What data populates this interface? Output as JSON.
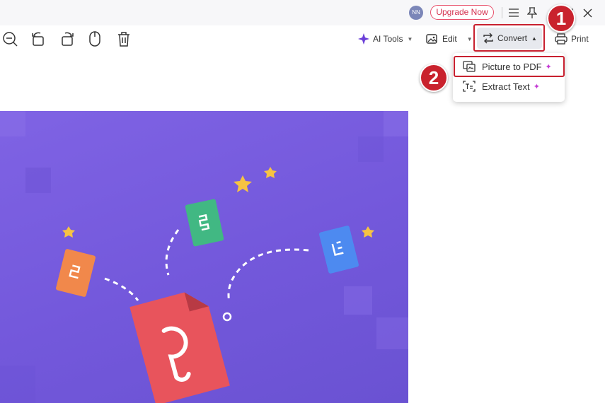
{
  "titlebar": {
    "avatar_initials": "NN",
    "upgrade_label": "Upgrade Now"
  },
  "toolbar": {
    "ai_tools_label": "AI Tools",
    "edit_label": "Edit",
    "convert_label": "Convert",
    "print_label": "Print"
  },
  "convert_menu": {
    "items": [
      {
        "label": "Picture to PDF",
        "ai": true
      },
      {
        "label": "Extract Text",
        "ai": true
      }
    ]
  },
  "annotations": {
    "step1": "1",
    "step2": "2",
    "color": "#c8202f"
  },
  "image": {
    "background_color": "#7358db"
  }
}
